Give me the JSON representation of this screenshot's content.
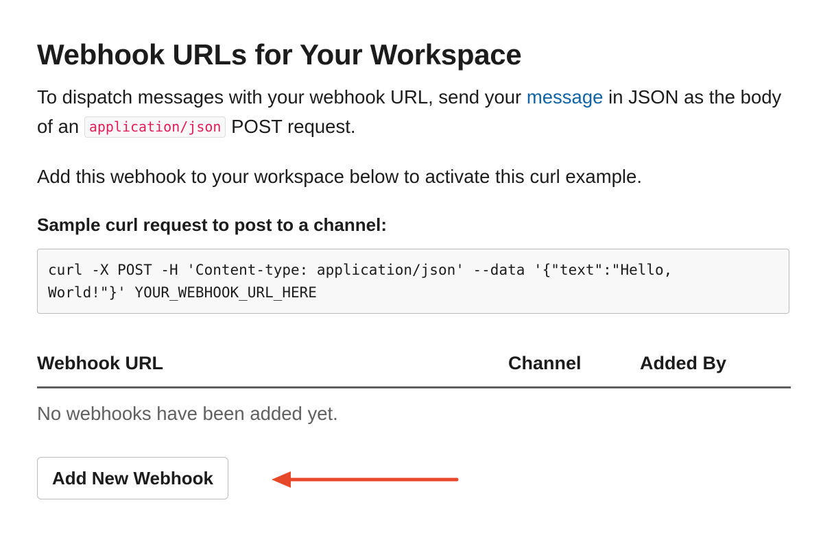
{
  "heading": "Webhook URLs for Your Workspace",
  "intro": {
    "text_before_link": "To dispatch messages with your webhook URL, send your ",
    "link": "message",
    "text_after_link": " in JSON as the body of an ",
    "code": "application/json",
    "text_end": " POST request."
  },
  "activate_text": "Add this webhook to your workspace below to activate this curl example.",
  "sample": {
    "heading": "Sample curl request to post to a channel:",
    "code_line1": "curl -X POST -H 'Content-type: application/json' --data '{\"text\":\"Hello,",
    "code_line2": "World!\"}' YOUR_WEBHOOK_URL_HERE"
  },
  "table": {
    "headers": [
      "Webhook URL",
      "Channel",
      "Added By"
    ],
    "empty_message": "No webhooks have been added yet."
  },
  "add_button_label": "Add New Webhook",
  "annotation": {
    "icon": "arrow-left-icon",
    "color": "#e8482a"
  },
  "colors": {
    "link": "#1264a3",
    "code_text": "#e01e5a",
    "muted_text": "#616061"
  }
}
